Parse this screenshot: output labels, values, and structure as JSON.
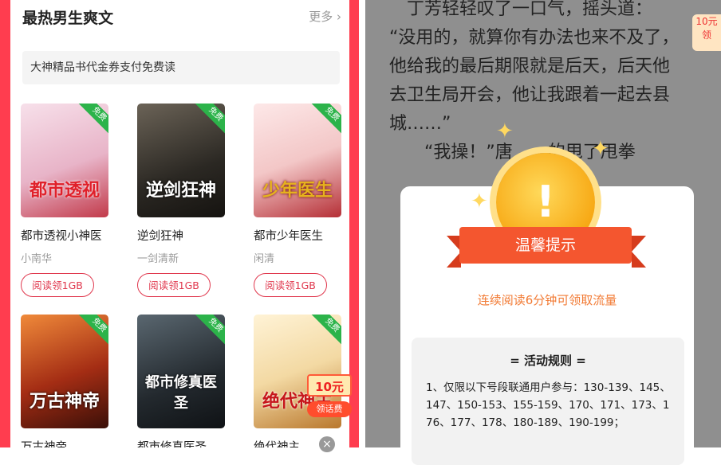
{
  "left": {
    "section_title": "最热男生爽文",
    "more_label": "更多",
    "banner_text": "大神精品书代金券支付免费读",
    "free_tag": "免费",
    "books": [
      {
        "cover_text": "都市透视",
        "title": "都市透视小神医",
        "author": "小南华",
        "button": "阅读领1GB"
      },
      {
        "cover_text": "逆剑狂神",
        "title": "逆剑狂神",
        "author": "一剑清新",
        "button": "阅读领1GB"
      },
      {
        "cover_text": "少年医生",
        "title": "都市少年医生",
        "author": "闲清",
        "button": "阅读领1GB"
      },
      {
        "cover_text": "万古神帝",
        "title": "万古神帝"
      },
      {
        "cover_text": "都市修真医圣",
        "title": "都市修真医圣"
      },
      {
        "cover_text": "绝代神主",
        "title": "绝代神主"
      }
    ],
    "coupon": {
      "amount": "10元",
      "label": "领话费"
    },
    "close_icon": "close-icon"
  },
  "right": {
    "story_lines": [
      "丁芳轻轻叹了一口气，摇头道：",
      "“没用的，就算你有办法也来不及了，",
      "他给我的最后期限就是后天，后天他",
      "去卫生局开会，他让我跟着一起去县",
      "城……”",
      "　　“我操！”唐　　的甩了甩拳"
    ],
    "side_coupon": {
      "amount": "10元",
      "label": "领"
    },
    "dialog": {
      "coin_mark": "!",
      "title": "温馨提示",
      "notice": "连续阅读6分钟可领取流量",
      "rules_title": "= 活动规则 =",
      "rules_text": "1、仅限以下号段联通用户参与：130-139、145、147、150-153、155-159、170、171、173、176、177、178、180-189、190-199；"
    }
  },
  "colors": {
    "accent": "#ff3d4f",
    "free_tag": "#2cb34a",
    "notice": "#f27b35",
    "ribbon": "#f4562f"
  }
}
